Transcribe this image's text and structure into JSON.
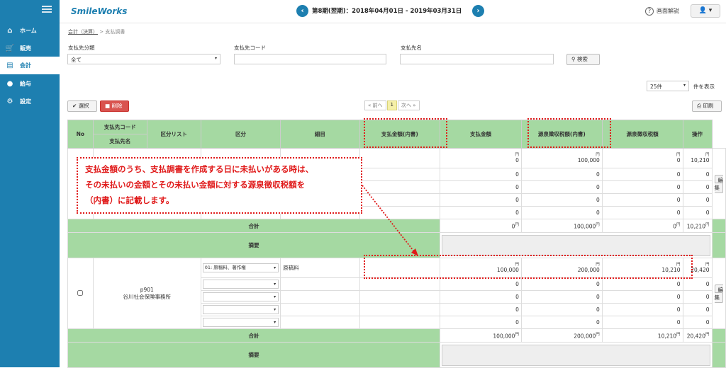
{
  "sidebar": {
    "items": [
      {
        "label": "ホーム",
        "icon": "home-icon"
      },
      {
        "label": "販売",
        "icon": "cart-icon"
      },
      {
        "label": "会計",
        "icon": "ledger-icon"
      },
      {
        "label": "給与",
        "icon": "moneybag-icon"
      },
      {
        "label": "設定",
        "icon": "gear-icon"
      }
    ]
  },
  "header": {
    "logo": "SmileWorks",
    "period": "第8期(翌期)：2018年04月01日 - 2019年03月31日",
    "help": "画面解説"
  },
  "breadcrumb": {
    "parent": "会計（決算）",
    "sep": ">",
    "current": "支払調書"
  },
  "filters": {
    "category_label": "支払先分類",
    "category_value": "全て",
    "code_label": "支払先コード",
    "name_label": "支払先名",
    "search_button": "検索"
  },
  "per_page": {
    "value": "25件",
    "suffix": "件を表示"
  },
  "toolbar": {
    "select": "選択",
    "delete": "削除",
    "print": "印刷"
  },
  "pager": {
    "prev": "« 前へ",
    "current": "1",
    "next": "次へ »"
  },
  "table": {
    "headers": {
      "no": "No",
      "code": "支払先コード",
      "name": "支払先名",
      "kubun_list": "区分リスト",
      "kubun": "区分",
      "detail": "細目",
      "pay_naisho": "支払金額(内書)",
      "pay": "支払金額",
      "tax_naisho": "源泉徴収税額(内書)",
      "tax": "源泉徴収税額",
      "action": "操作"
    },
    "yen": "円",
    "total_label": "合計",
    "memo_label": "摘要",
    "edit_button": "編集",
    "group1": {
      "rows": [
        [
          "0",
          "100,000",
          "0",
          "10,210"
        ],
        [
          "0",
          "0",
          "0",
          "0"
        ],
        [
          "0",
          "0",
          "0",
          "0"
        ],
        [
          "0",
          "0",
          "0",
          "0"
        ],
        [
          "0",
          "0",
          "0",
          "0"
        ]
      ],
      "totals": [
        "0",
        "100,000",
        "0",
        "10,210"
      ]
    },
    "group2": {
      "code": "p901",
      "name": "谷川社会保険事務所",
      "select_first": "01: 原稿料、著作権",
      "kubun_first": "原稿料",
      "rows": [
        [
          "100,000",
          "200,000",
          "10,210",
          "20,420"
        ],
        [
          "0",
          "0",
          "0",
          "0"
        ],
        [
          "0",
          "0",
          "0",
          "0"
        ],
        [
          "0",
          "0",
          "0",
          "0"
        ],
        [
          "0",
          "0",
          "0",
          "0"
        ]
      ],
      "totals": [
        "100,000",
        "200,000",
        "10,210",
        "20,420"
      ]
    }
  },
  "annotation": {
    "line1": "支払金額のうち、支払調書を作成する日に未払いがある時は、",
    "line2": "その未払いの金額とその未払い金額に対する源泉徴収税額を",
    "line3": "（内書）に記載します。"
  },
  "colors": {
    "sidebar": "#1d7fb0",
    "header_green": "#a5d9a2",
    "annotation_red": "#e01a1a"
  }
}
